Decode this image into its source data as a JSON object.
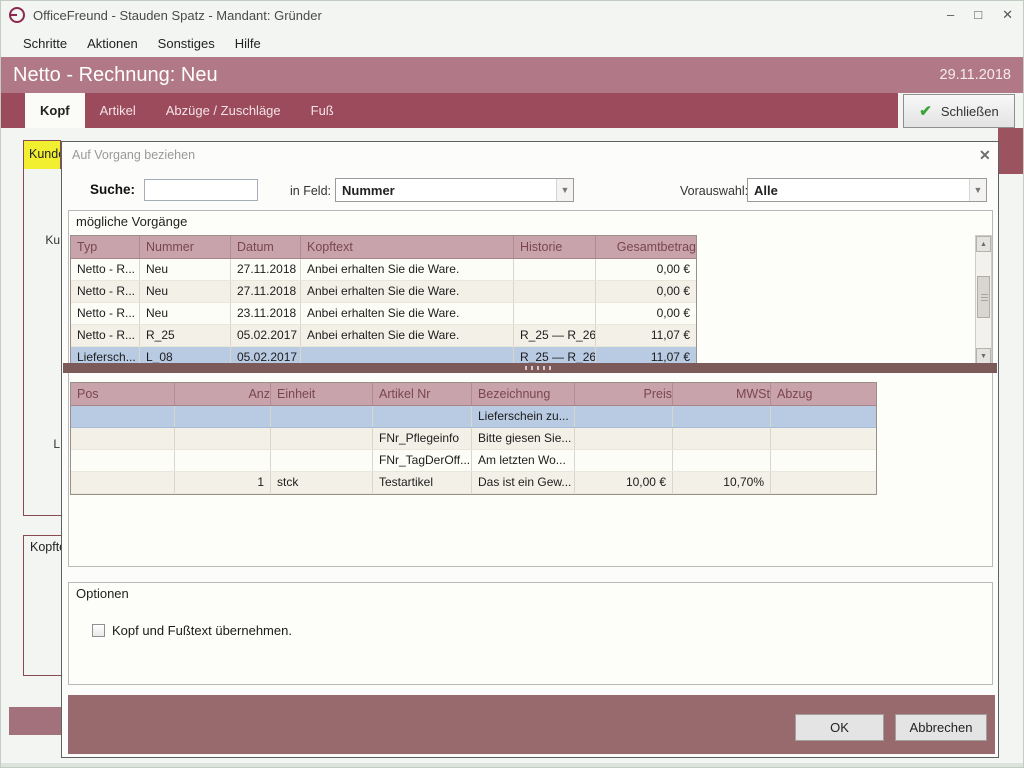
{
  "colors": {
    "brand_maroon": "#8a2a50",
    "header_rose": "#b17887",
    "tabbar_red": "#9c4b5c",
    "table_header_pink": "#c9a3ab",
    "table_header_text": "#7a4650",
    "selection_blue": "#b9cbe3",
    "splitter_brown": "#7b5a59",
    "dialog_footer_rose": "#986a6e",
    "check_green": "#3aa43a",
    "kunde_tab_yellow": "#f1ef2f"
  },
  "window": {
    "title": "OfficeFreund  -  Stauden Spatz  -  Mandant: Gründer",
    "minimize_glyph": "–",
    "maximize_glyph": "□",
    "close_glyph": "✕"
  },
  "menu": {
    "items": [
      {
        "label": "Schritte"
      },
      {
        "label": "Aktionen"
      },
      {
        "label": "Sonstiges"
      },
      {
        "label": "Hilfe"
      }
    ]
  },
  "header": {
    "title": "Netto - Rechnung: Neu",
    "date": "29.11.2018"
  },
  "tabs": {
    "active": "Kopf",
    "items": [
      {
        "label": "Kopf"
      },
      {
        "label": "Artikel"
      },
      {
        "label": "Abzüge / Zuschläge"
      },
      {
        "label": "Fuß"
      }
    ]
  },
  "toolbar": {
    "close_label": "Schließen",
    "check_glyph": "✔"
  },
  "background_form": {
    "kunde_tab": "Kunde",
    "label_kunde_short": "Ku",
    "label_land_short": "L",
    "kopftext_label": "Kopfte"
  },
  "dialog": {
    "title": "Auf Vorgang beziehen",
    "close_glyph": "✕",
    "search": {
      "label": "Suche:",
      "value": "",
      "in_feld_label": "in Feld:",
      "in_feld_value": "Nummer",
      "vorauswahl_label": "Vorauswahl:",
      "vorauswahl_value": "Alle",
      "arrow_glyph": "▼"
    },
    "vorgaenge": {
      "group_label": "mögliche Vorgänge",
      "columns": [
        "Typ",
        "Nummer",
        "Datum",
        "Kopftext",
        "Historie",
        "Gesamtbetrag"
      ],
      "rows": [
        [
          "Netto - R...",
          "Neu",
          "27.11.2018",
          "Anbei erhalten Sie die Ware.",
          "",
          "0,00 €"
        ],
        [
          "Netto - R...",
          "Neu",
          "27.11.2018",
          "Anbei erhalten Sie die Ware.",
          "",
          "0,00 €"
        ],
        [
          "Netto - R...",
          "Neu",
          "23.11.2018",
          "Anbei erhalten Sie die Ware.",
          "",
          "0,00 €"
        ],
        [
          "Netto - R...",
          "R_25",
          "05.02.2017",
          "Anbei erhalten Sie die Ware.",
          "R_25 — R_26",
          "11,07 €"
        ],
        [
          "Liefersch...",
          "L_08",
          "05.02.2017",
          "",
          "R_25 — R_26",
          "11,07 €"
        ]
      ],
      "selected_index": 4,
      "scroll_up_glyph": "▲",
      "scroll_down_glyph": "▼"
    },
    "positionen": {
      "columns": [
        "Pos",
        "Anz",
        "Einheit",
        "Artikel Nr",
        "Bezeichnung",
        "Preis",
        "MWSt",
        "Abzug"
      ],
      "rows": [
        [
          "",
          "",
          "",
          "",
          "Lieferschein zu...",
          "",
          "",
          ""
        ],
        [
          "",
          "",
          "",
          "FNr_Pflegeinfo",
          "Bitte giesen Sie...",
          "",
          "",
          ""
        ],
        [
          "",
          "",
          "",
          "FNr_TagDerOff...",
          "Am letzten Wo...",
          "",
          "",
          ""
        ],
        [
          "",
          "1",
          "stck",
          "Testartikel",
          "Das ist ein Gew...",
          "10,00 €",
          "10,70%",
          ""
        ]
      ],
      "selected_index": 0
    },
    "options": {
      "group_label": "Optionen",
      "checkbox_label": "Kopf und Fußtext übernehmen.",
      "checked": false
    },
    "footer": {
      "ok_label": "OK",
      "cancel_label": "Abbrechen"
    }
  }
}
